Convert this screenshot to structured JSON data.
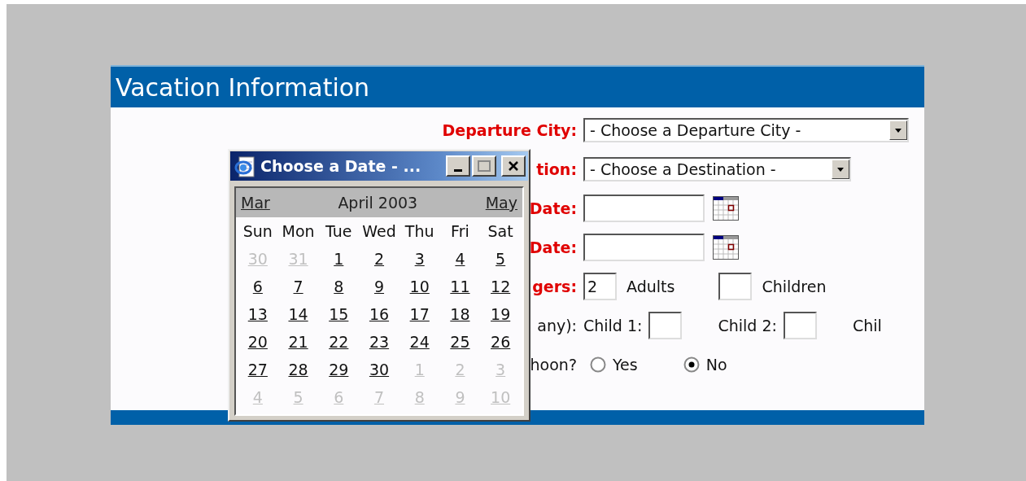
{
  "section_title": "Vacation Information",
  "form_rows": [
    {
      "kind": "select",
      "label": "Departure City:",
      "required": true,
      "value": "- Choose a Departure City -",
      "wide": true
    },
    {
      "kind": "select",
      "label": "tion:",
      "required": true,
      "value": "- Choose a Destination -",
      "wide": false
    },
    {
      "kind": "date",
      "label": "Date:",
      "required": true
    },
    {
      "kind": "date",
      "label": "Date:",
      "required": true
    },
    {
      "kind": "counts",
      "label": "gers:",
      "required": true,
      "fields": [
        {
          "value": "2",
          "caption": "Adults"
        },
        {
          "caption": "Children"
        }
      ]
    },
    {
      "kind": "ages",
      "label": "any):",
      "required": false,
      "fields": [
        {
          "caption": "Child 1:",
          "box": true
        },
        {
          "caption": "Child 2:",
          "box": true
        },
        {
          "caption": "Chil",
          "box": false
        }
      ]
    },
    {
      "kind": "radio",
      "label": "hoon?",
      "required": false,
      "options": [
        {
          "label": "Yes",
          "selected": false
        },
        {
          "label": "No",
          "selected": true
        }
      ]
    }
  ],
  "date_popup": {
    "title": "Choose a Date - ...",
    "prev_month": "Mar",
    "month": "April 2003",
    "next_month": "May",
    "weekdays": [
      "Sun",
      "Mon",
      "Tue",
      "Wed",
      "Thu",
      "Fri",
      "Sat"
    ],
    "weeks": [
      [
        {
          "day": "30",
          "current": false
        },
        {
          "day": "31",
          "current": false
        },
        {
          "day": "1",
          "current": true
        },
        {
          "day": "2",
          "current": true
        },
        {
          "day": "3",
          "current": true
        },
        {
          "day": "4",
          "current": true
        },
        {
          "day": "5",
          "current": true
        }
      ],
      [
        {
          "day": "6",
          "current": true
        },
        {
          "day": "7",
          "current": true
        },
        {
          "day": "8",
          "current": true
        },
        {
          "day": "9",
          "current": true
        },
        {
          "day": "10",
          "current": true
        },
        {
          "day": "11",
          "current": true
        },
        {
          "day": "12",
          "current": true
        }
      ],
      [
        {
          "day": "13",
          "current": true
        },
        {
          "day": "14",
          "current": true
        },
        {
          "day": "15",
          "current": true
        },
        {
          "day": "16",
          "current": true
        },
        {
          "day": "17",
          "current": true
        },
        {
          "day": "18",
          "current": true
        },
        {
          "day": "19",
          "current": true
        }
      ],
      [
        {
          "day": "20",
          "current": true
        },
        {
          "day": "21",
          "current": true
        },
        {
          "day": "22",
          "current": true
        },
        {
          "day": "23",
          "current": true
        },
        {
          "day": "24",
          "current": true
        },
        {
          "day": "25",
          "current": true
        },
        {
          "day": "26",
          "current": true
        }
      ],
      [
        {
          "day": "27",
          "current": true
        },
        {
          "day": "28",
          "current": true
        },
        {
          "day": "29",
          "current": true
        },
        {
          "day": "30",
          "current": true
        },
        {
          "day": "1",
          "current": false
        },
        {
          "day": "2",
          "current": false
        },
        {
          "day": "3",
          "current": false
        }
      ],
      [
        {
          "day": "4",
          "current": false
        },
        {
          "day": "5",
          "current": false
        },
        {
          "day": "6",
          "current": false
        },
        {
          "day": "7",
          "current": false
        },
        {
          "day": "8",
          "current": false
        },
        {
          "day": "9",
          "current": false
        },
        {
          "day": "10",
          "current": false
        }
      ]
    ]
  }
}
